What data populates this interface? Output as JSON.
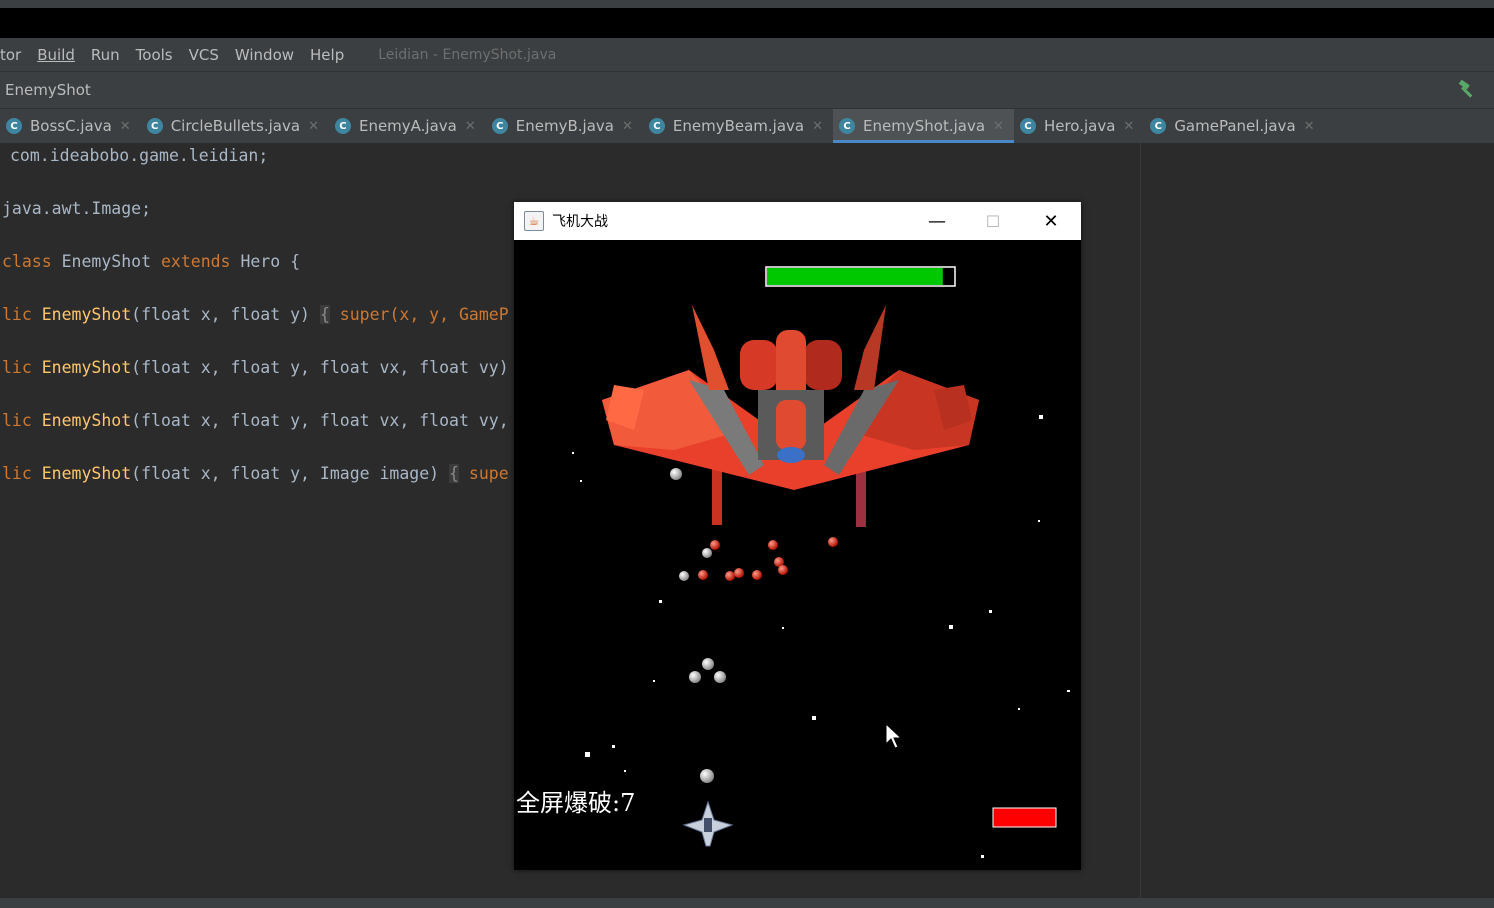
{
  "menu": {
    "items": [
      "tor",
      "Build",
      "Run",
      "Tools",
      "VCS",
      "Window",
      "Help"
    ],
    "window_title": "Leidian - EnemyShot.java"
  },
  "navbar": {
    "breadcrumb": "EnemyShot"
  },
  "tabs": [
    {
      "label": "BossC.java",
      "active": false
    },
    {
      "label": "CircleBullets.java",
      "active": false
    },
    {
      "label": "EnemyA.java",
      "active": false
    },
    {
      "label": "EnemyB.java",
      "active": false
    },
    {
      "label": "EnemyBeam.java",
      "active": false
    },
    {
      "label": "EnemyShot.java",
      "active": true
    },
    {
      "label": "Hero.java",
      "active": false
    },
    {
      "label": "GamePanel.java",
      "active": false
    }
  ],
  "code": {
    "line1": "com.ideabobo.game.leidian;",
    "line2": "java.awt.Image;",
    "line3_kw": "class",
    "line3_name": "EnemyShot",
    "line3_ext": "extends",
    "line3_rest": "Hero {",
    "lic": "lic",
    "ctor": "EnemyShot",
    "ctor1_args": "(float x, float y)",
    "ctor1_fold": "{",
    "ctor1_tail": "super(x, y, GameP",
    "ctor2_args": "(float x, float y, float vx, float vy)",
    "ctor3_args": "(float x, float y, float vx, float vy,",
    "ctor4_args": "(float x, float y, Image image)",
    "ctor4_fold": "{",
    "ctor4_tail": "supe"
  },
  "game_window": {
    "title": "飞机大战",
    "minimize_glyph": "—",
    "maximize_glyph": "☐",
    "close_glyph": "✕",
    "bomb_label": "全屏爆破:7",
    "boss_health_fraction": 0.94,
    "colors": {
      "health_bar": "#00c800",
      "player_bar": "#ff0000",
      "boss_hull": "#e8402a"
    }
  }
}
